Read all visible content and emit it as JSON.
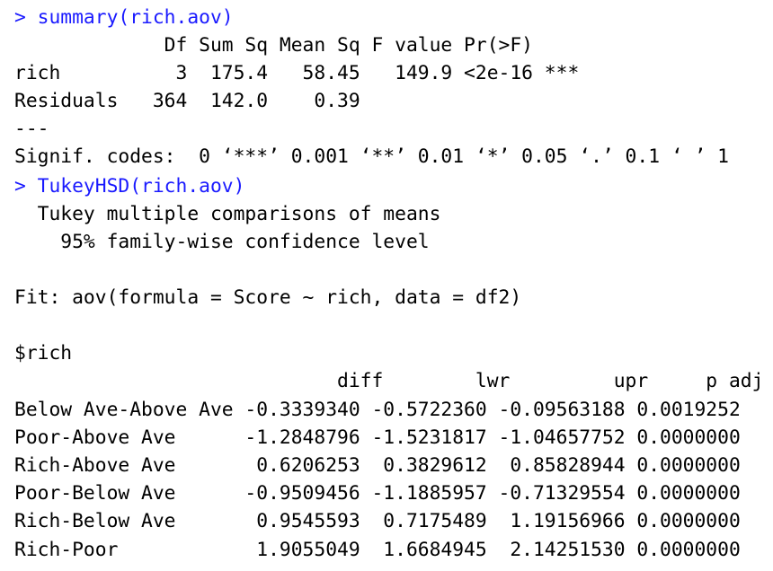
{
  "console": {
    "lines": [
      {
        "kind": "input",
        "text": "> summary(rich.aov)"
      },
      {
        "kind": "output",
        "text": "             Df Sum Sq Mean Sq F value Pr(>F)    "
      },
      {
        "kind": "output",
        "text": "rich          3  175.4   58.45   149.9 <2e-16 ***"
      },
      {
        "kind": "output",
        "text": "Residuals   364  142.0    0.39                   "
      },
      {
        "kind": "output",
        "text": "---"
      },
      {
        "kind": "output",
        "text": "Signif. codes:  0 ‘***’ 0.001 ‘**’ 0.01 ‘*’ 0.05 ‘.’ 0.1 ‘ ’ 1"
      },
      {
        "kind": "input",
        "text": "> TukeyHSD(rich.aov)"
      },
      {
        "kind": "output",
        "text": "  Tukey multiple comparisons of means"
      },
      {
        "kind": "output",
        "text": "    95% family-wise confidence level"
      },
      {
        "kind": "output",
        "text": ""
      },
      {
        "kind": "output",
        "text": "Fit: aov(formula = Score ~ rich, data = df2)"
      },
      {
        "kind": "output",
        "text": ""
      },
      {
        "kind": "output",
        "text": "$rich"
      },
      {
        "kind": "output",
        "text": "                            diff        lwr         upr     p adj"
      },
      {
        "kind": "output",
        "text": "Below Ave-Above Ave -0.3339340 -0.5722360 -0.09563188 0.0019252"
      },
      {
        "kind": "output",
        "text": "Poor-Above Ave      -1.2848796 -1.5231817 -1.04657752 0.0000000"
      },
      {
        "kind": "output",
        "text": "Rich-Above Ave       0.6206253  0.3829612  0.85828944 0.0000000"
      },
      {
        "kind": "output",
        "text": "Poor-Below Ave      -0.9509456 -1.1885957 -0.71329554 0.0000000"
      },
      {
        "kind": "output",
        "text": "Rich-Below Ave       0.9545593  0.7175489  1.19156966 0.0000000"
      },
      {
        "kind": "output",
        "text": "Rich-Poor            1.9055049  1.6684945  2.14251530 0.0000000"
      }
    ]
  }
}
